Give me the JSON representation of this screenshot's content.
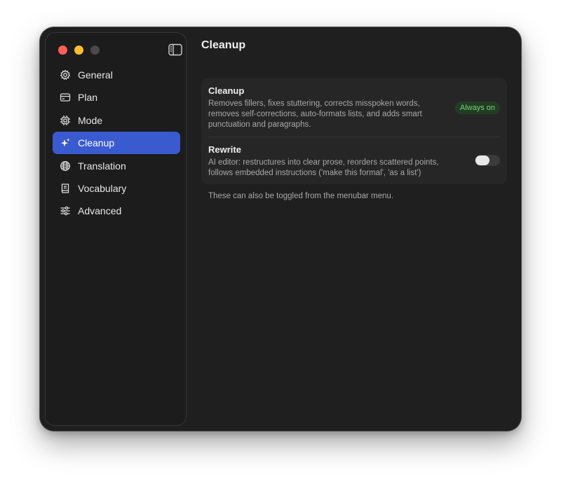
{
  "sidebar": {
    "items": [
      {
        "label": "General",
        "icon": "gear-icon",
        "active": false
      },
      {
        "label": "Plan",
        "icon": "card-icon",
        "active": false
      },
      {
        "label": "Mode",
        "icon": "chip-icon",
        "active": false
      },
      {
        "label": "Cleanup",
        "icon": "sparkle-icon",
        "active": true
      },
      {
        "label": "Translation",
        "icon": "globe-icon",
        "active": false
      },
      {
        "label": "Vocabulary",
        "icon": "book-icon",
        "active": false
      },
      {
        "label": "Advanced",
        "icon": "sliders-icon",
        "active": false
      }
    ]
  },
  "main": {
    "title": "Cleanup",
    "options": [
      {
        "title": "Cleanup",
        "description": "Removes fillers, fixes stuttering, corrects misspoken words, removes self-corrections, auto-formats lists, and adds smart punctuation and paragraphs.",
        "badge": "Always on"
      },
      {
        "title": "Rewrite",
        "description": "AI editor: restructures into clear prose, reorders scattered points, follows embedded instructions ('make this formal', 'as a list')",
        "enabled": false
      }
    ],
    "footnote": "These can also be toggled from the menubar menu."
  },
  "colors": {
    "accent": "#3a5bd0",
    "badge_text": "#6fd673",
    "close": "#ff5f57",
    "minimize": "#febc2e"
  }
}
